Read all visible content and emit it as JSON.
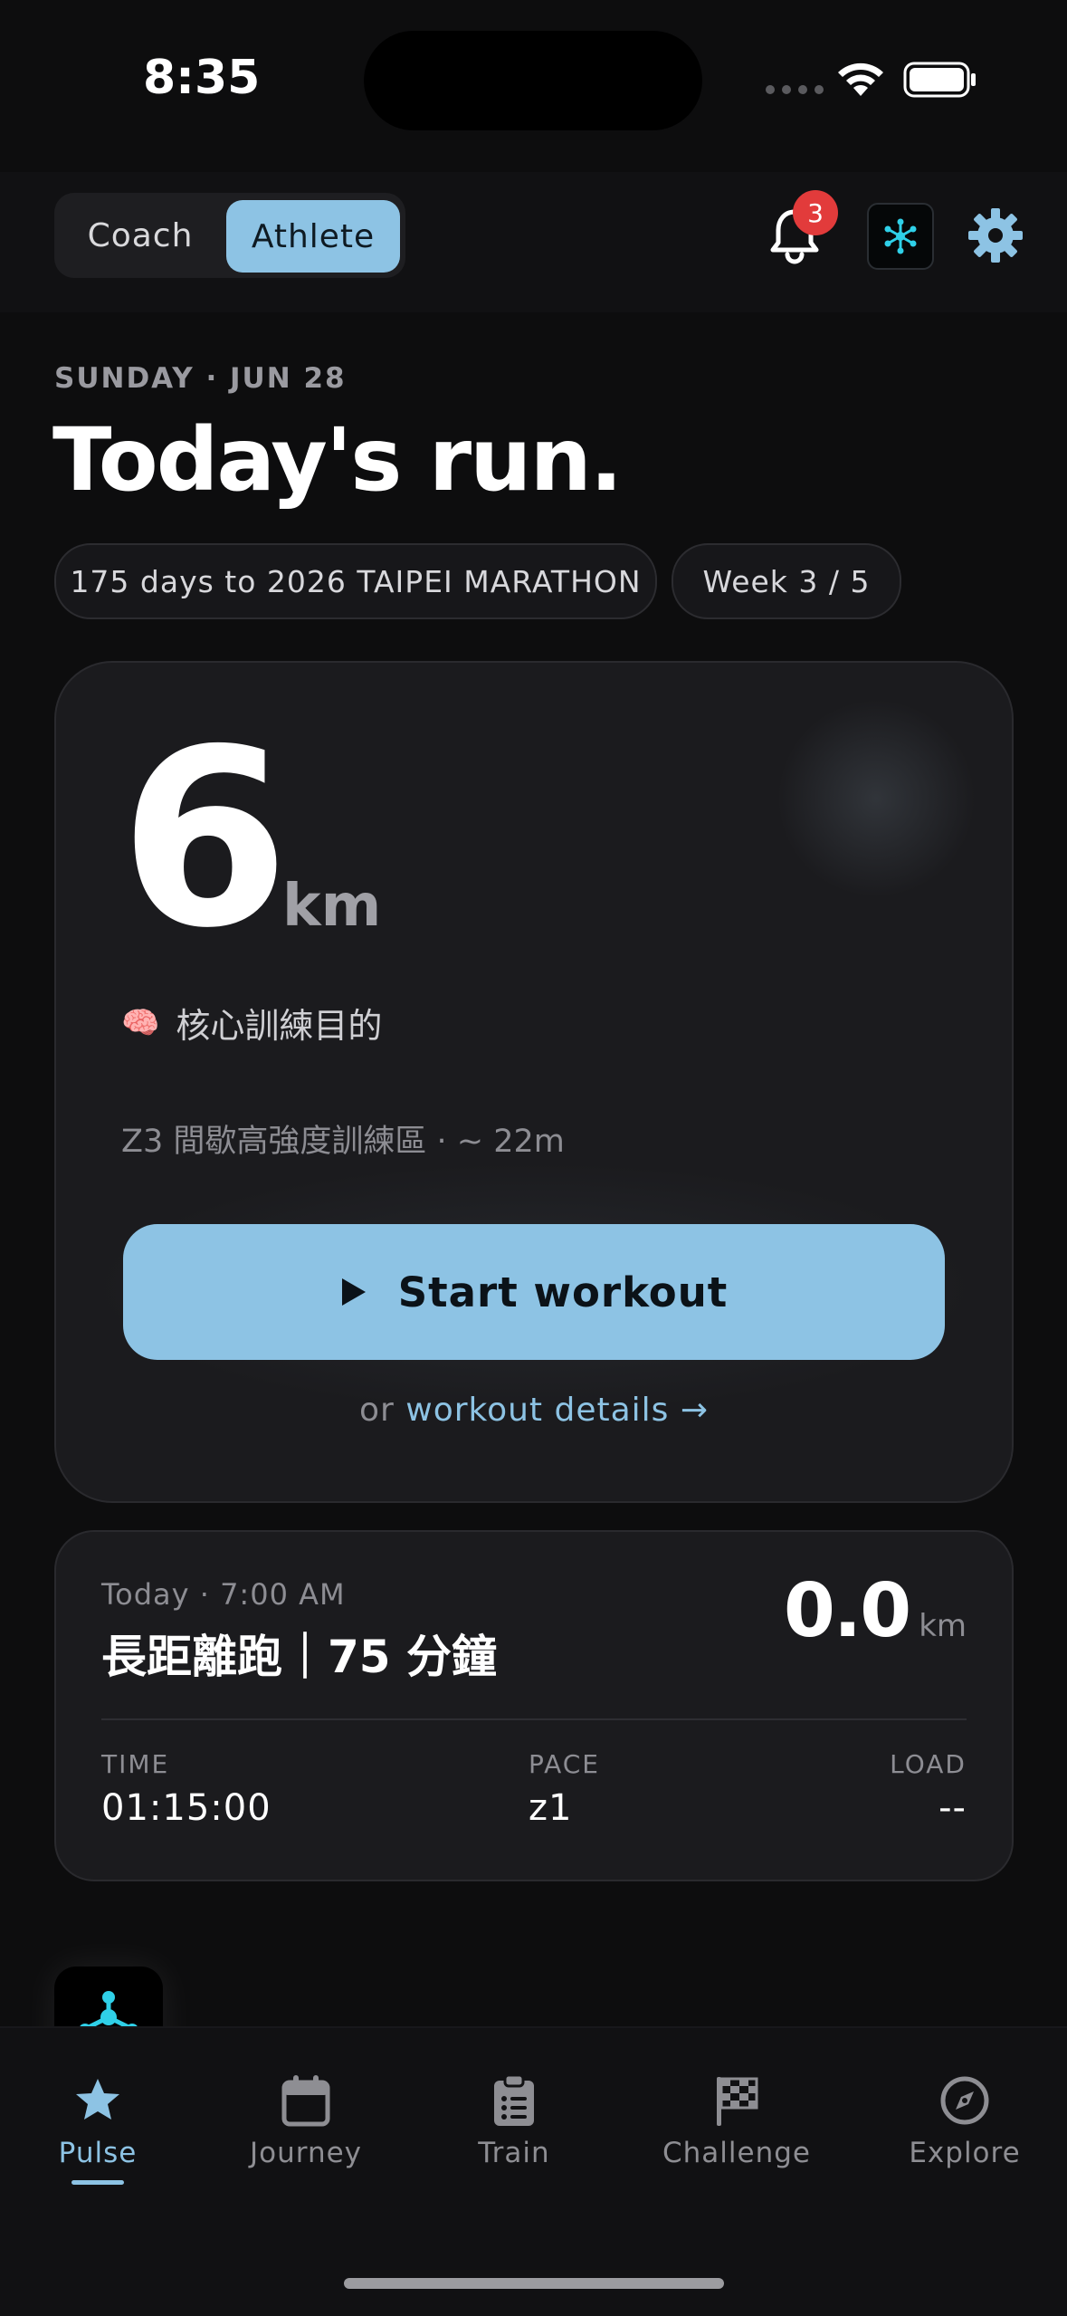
{
  "status_bar": {
    "time": "8:35"
  },
  "header": {
    "mode_toggle": {
      "options": [
        "Coach",
        "Athlete"
      ],
      "selected": "Athlete"
    },
    "notifications": {
      "icon": "bell-icon",
      "count": "3"
    },
    "app_logo_icon": "network-logo-icon",
    "settings_icon": "gear-icon"
  },
  "hero": {
    "date": "SUNDAY · JUN 28",
    "title": "Today's run.",
    "countdown_pill": "175 days to 2026 TAIPEI MARATHON",
    "week_pill": "Week 3 / 5"
  },
  "today_card": {
    "distance": "6",
    "unit": "km",
    "purpose_icon": "🧠",
    "purpose": "核心訓練目的",
    "zone_info": "Z3 間歇高強度訓練區  ·  ~ 22m",
    "start_label": "Start workout",
    "details_prefix": "or",
    "details_link": "workout details →"
  },
  "workout_card": {
    "when": "Today · 7:00 AM",
    "title": "長距離跑｜75 分鐘",
    "distance": "0.0",
    "unit": "km",
    "stats": [
      {
        "label": "TIME",
        "value": "01:15:00"
      },
      {
        "label": "PACE",
        "value": "z1"
      },
      {
        "label": "LOAD",
        "value": "--"
      }
    ]
  },
  "tabbar": {
    "tabs": [
      {
        "label": "Pulse",
        "icon": "star-icon",
        "active": true
      },
      {
        "label": "Journey",
        "icon": "calendar-icon",
        "active": false
      },
      {
        "label": "Train",
        "icon": "clipboard-icon",
        "active": false
      },
      {
        "label": "Challenge",
        "icon": "checkered-flag-icon",
        "active": false
      },
      {
        "label": "Explore",
        "icon": "compass-icon",
        "active": false
      }
    ]
  },
  "colors": {
    "accent": "#8dc3e4",
    "background": "#0d0d0e",
    "card": "#1b1b1e",
    "badge": "#e23b3b",
    "logo_cyan": "#2fd0e8"
  }
}
